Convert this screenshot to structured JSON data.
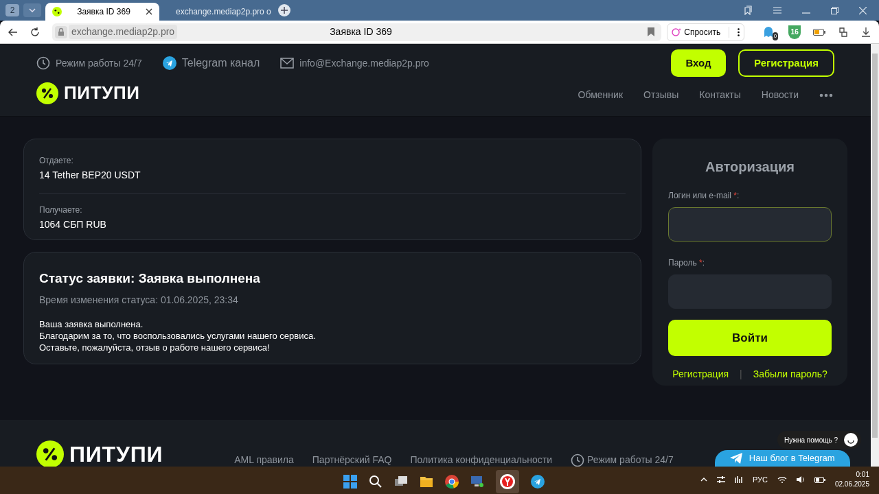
{
  "browser": {
    "tab_count": "2",
    "tabs": [
      {
        "title": "Заявка ID 369",
        "selected": true,
        "kind": "percent"
      },
      {
        "title": "exchange.mediap2p.pro o",
        "selected": false,
        "kind": "mask"
      }
    ],
    "url": "exchange.mediap2p.pro",
    "page_title": "Заявка ID 369",
    "ask_button": "Спросить",
    "extension_badge": "0",
    "shield_count": "16"
  },
  "header": {
    "info": [
      {
        "kind": "clock",
        "text": "Режим работы 24/7"
      },
      {
        "kind": "telegram",
        "text": "Telegram канал"
      },
      {
        "kind": "mail",
        "text": "info@Exchange.mediap2p.pro"
      }
    ],
    "logo": "ПИТУПИ",
    "login_button": "Вход",
    "register_button": "Регистрация",
    "nav": [
      "Обменник",
      "Отзывы",
      "Контакты",
      "Новости"
    ]
  },
  "order": {
    "give_label": "Отдаете:",
    "give_value": "14 Tether BEP20 USDT",
    "receive_label": "Получаете:",
    "receive_value": "1064 СБП RUB"
  },
  "status": {
    "title": "Статус заявки: Заявка выполнена",
    "time": "Время изменения статуса: 01.06.2025, 23:34",
    "message": [
      "Ваша заявка выполнена.",
      "Благодарим за то, что воспользовались услугами нашего сервиса.",
      "Оставьте, пожалуйста, отзыв о работе нашего сервиса!"
    ]
  },
  "auth": {
    "title": "Авторизация",
    "fields": [
      {
        "label": "Логин или e-mail",
        "required": "*",
        "suffix": ":",
        "focused": true
      },
      {
        "label": "Пароль",
        "required": "*",
        "suffix": ":",
        "focused": false
      }
    ],
    "submit": "Войти",
    "links": [
      "Регистрация",
      "Забыли пароль?"
    ],
    "separator": "|"
  },
  "footer": {
    "logo": "ПИТУПИ",
    "links": [
      "AML правила",
      "Партнёрский FAQ",
      "Политика конфиденциальности"
    ],
    "hours": "Режим работы 24/7",
    "telegram_button": "Наш блог в Telegram",
    "help": "Нужна помощь ?"
  },
  "taskbar": {
    "language": "РУС",
    "time": "0:01",
    "date": "02.06.2025"
  }
}
